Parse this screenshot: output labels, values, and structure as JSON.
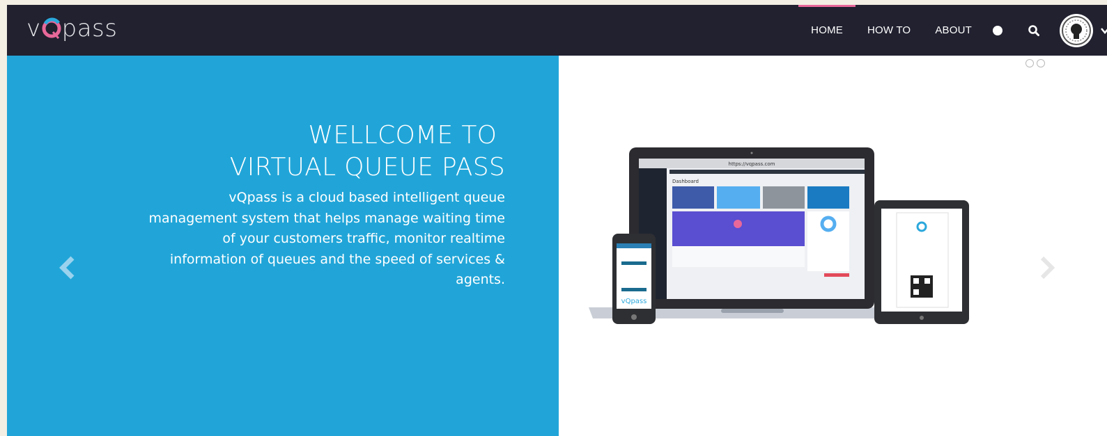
{
  "brand": {
    "name_prefix": "v",
    "name_suffix": "pass",
    "accent": "#e8689a",
    "blue": "#21a5d8",
    "nav_bg": "#212130"
  },
  "nav": {
    "items": [
      {
        "label": "HOME",
        "active": true
      },
      {
        "label": "HOW TO",
        "active": false
      },
      {
        "label": "ABOUT",
        "active": false
      }
    ],
    "icons": [
      "status-dot-icon",
      "search-icon",
      "avatar",
      "chevron-down-icon"
    ]
  },
  "hero": {
    "title_line1": "WELLCOME TO ",
    "title_line2": "VIRTUAL QUEUE PASS",
    "description": "vQpass is a cloud based intelligent queue management system that helps manage waiting time of your customers traffic, monitor realtime information of queues and the speed of services & agents."
  },
  "carousel": {
    "indicator_count": 2,
    "prev_icon": "chevron-left-icon",
    "next_icon": "chevron-right-icon"
  },
  "mockup": {
    "url": "https://vqpass.com",
    "dashboard_title": "Dashboard",
    "phone_logo": "vQpass"
  }
}
